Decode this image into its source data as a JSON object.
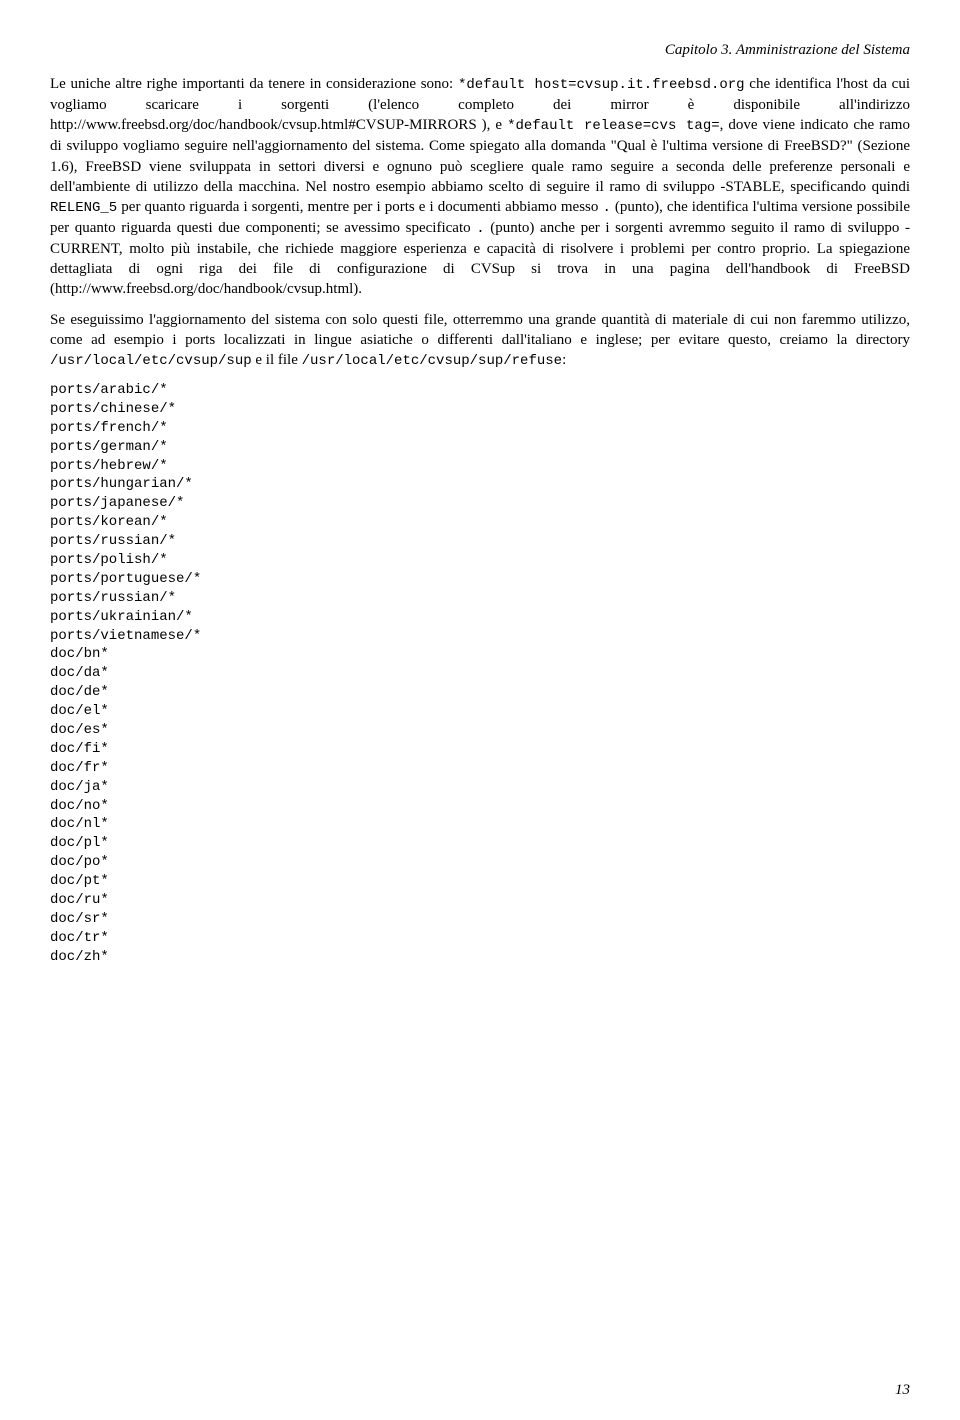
{
  "header": "Capitolo 3. Amministrazione del Sistema",
  "p1a": "Le uniche altre righe importanti da tenere in considerazione sono: ",
  "p1code1": "*default host=cvsup.it.freebsd.org",
  "p1b": " che identifica l'host da cui vogliamo scaricare i sorgenti (l'elenco completo dei mirror è disponibile all'indirizzo http://www.freebsd.org/doc/handbook/cvsup.html#CVSUP-MIRRORS ), e ",
  "p1code2": "*default release=cvs tag=",
  "p1c": ", dove viene indicato che ramo di sviluppo vogliamo seguire nell'aggiornamento del sistema. Come spiegato alla domanda \"Qual è l'ultima versione di FreeBSD?\" (Sezione 1.6), FreeBSD viene sviluppata in settori diversi e ognuno può scegliere quale ramo seguire a seconda delle preferenze personali e dell'ambiente di utilizzo della macchina. Nel nostro esempio abbiamo scelto di seguire il ramo di sviluppo -STABLE, specificando quindi ",
  "p1code3": "RELENG_5",
  "p1d": " per quanto riguarda i sorgenti, mentre per i ports e i documenti abbiamo messo ",
  "p1code4": ".",
  "p1e": " (punto), che identifica l'ultima versione possibile per quanto riguarda questi due componenti; se avessimo specificato ",
  "p1code5": ".",
  "p1f": " (punto) anche per i sorgenti avremmo seguito il ramo di sviluppo -CURRENT, molto più instabile, che richiede maggiore esperienza e capacità di risolvere i problemi per contro proprio. La spiegazione dettagliata di ogni riga dei file di configurazione di CVSup si trova in una pagina dell'handbook di FreeBSD (http://www.freebsd.org/doc/handbook/cvsup.html).",
  "p2a": "Se eseguissimo l'aggiornamento del sistema con solo questi file, otterremmo una grande quantità di materiale di cui non faremmo utilizzo, come ad esempio i ports localizzati in lingue asiatiche o differenti dall'italiano e inglese; per evitare questo, creiamo la directory ",
  "p2code1": "/usr/local/etc/cvsup/sup",
  "p2b": " e il file ",
  "p2code2": "/usr/local/etc/cvsup/sup/refuse",
  "p2c": ":",
  "refuse": [
    "ports/arabic/*",
    "ports/chinese/*",
    "ports/french/*",
    "ports/german/*",
    "ports/hebrew/*",
    "ports/hungarian/*",
    "ports/japanese/*",
    "ports/korean/*",
    "ports/russian/*",
    "ports/polish/*",
    "ports/portuguese/*",
    "ports/russian/*",
    "ports/ukrainian/*",
    "ports/vietnamese/*",
    "doc/bn*",
    "doc/da*",
    "doc/de*",
    "doc/el*",
    "doc/es*",
    "doc/fi*",
    "doc/fr*",
    "doc/ja*",
    "doc/no*",
    "doc/nl*",
    "doc/pl*",
    "doc/po*",
    "doc/pt*",
    "doc/ru*",
    "doc/sr*",
    "doc/tr*",
    "doc/zh*"
  ],
  "pagenum": "13"
}
